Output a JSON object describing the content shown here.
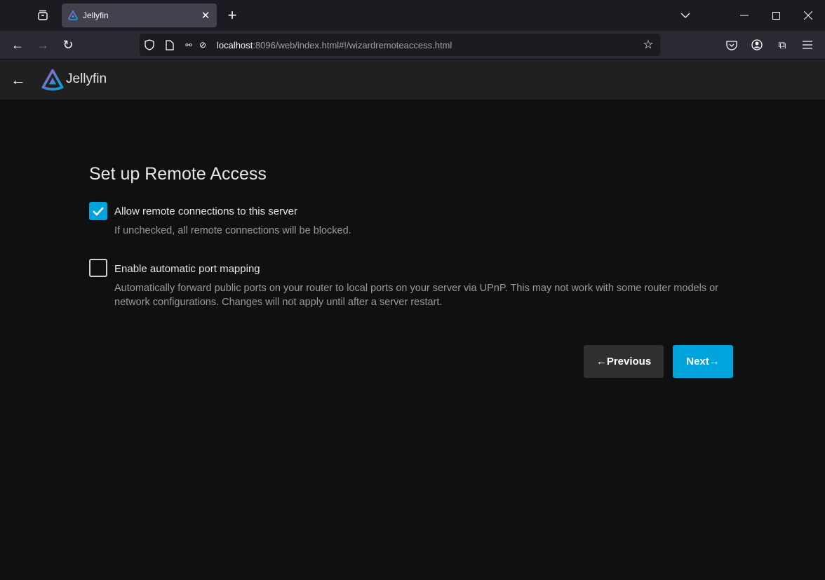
{
  "browser": {
    "tab_title": "Jellyfin",
    "url_host": "localhost",
    "url_rest": ":8096/web/index.html#!/wizardremoteaccess.html"
  },
  "app": {
    "brand": "Jellyfin"
  },
  "page": {
    "title": "Set up Remote Access",
    "options": [
      {
        "label": "Allow remote connections to this server",
        "description": "If unchecked, all remote connections will be blocked.",
        "checked": true
      },
      {
        "label": "Enable automatic port mapping",
        "description": "Automatically forward public ports on your router to local ports on your server via UPnP. This may not work with some router models or network configurations. Changes will not apply until after a server restart.",
        "checked": false
      }
    ],
    "previous_label": "Previous",
    "next_label": "Next"
  },
  "colors": {
    "accent": "#00a4dc"
  }
}
